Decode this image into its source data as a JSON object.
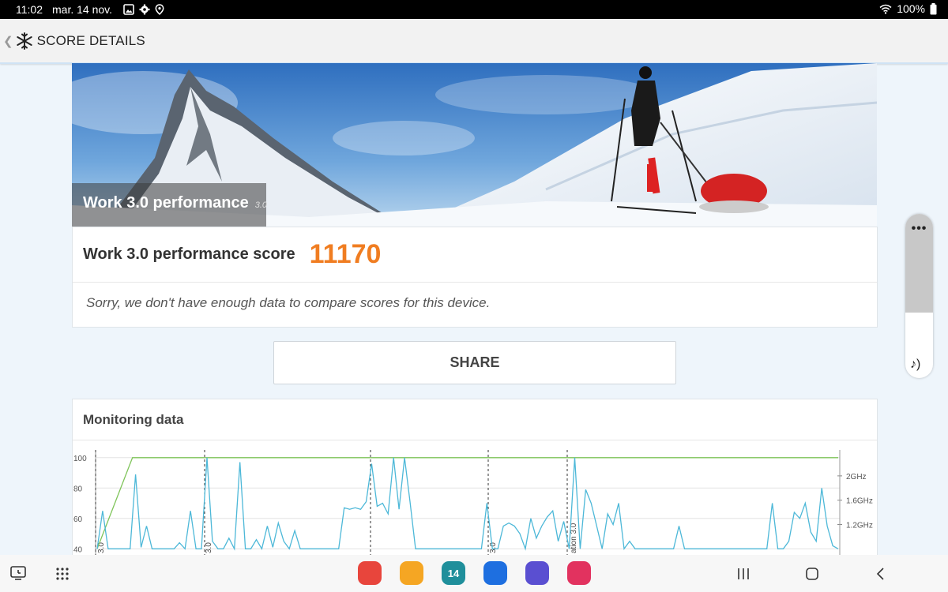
{
  "status_bar": {
    "time": "11:02",
    "date": "mar. 14 nov.",
    "battery": "100%",
    "icons": [
      "gallery-icon",
      "gear-icon",
      "location-icon",
      "wifi-icon",
      "battery-icon"
    ]
  },
  "app_bar": {
    "title": "SCORE DETAILS",
    "icons": [
      "back-icon",
      "snowflake-icon"
    ]
  },
  "hero": {
    "title": "Work 3.0 performance",
    "version": "3.0"
  },
  "score": {
    "label": "Work 3.0 performance score",
    "value": "11170",
    "compare_text": "Sorry, we don't have enough data to compare scores for this device."
  },
  "share_button": {
    "label": "SHARE"
  },
  "monitoring": {
    "title": "Monitoring data"
  },
  "chart_data": {
    "type": "line",
    "y_left_ticks": [
      "100",
      "80",
      "60",
      "40"
    ],
    "y_right_ticks": [
      "2GHz",
      "1.6GHz",
      "1.2GHz"
    ],
    "ylim": [
      36,
      103
    ],
    "marker_labels": [
      "3.0",
      "3.0",
      "3.0",
      "ation 3.0"
    ],
    "series": [
      {
        "color": "#7fc45a",
        "values": [
          40,
          100,
          100,
          100,
          100,
          100,
          100,
          100,
          100,
          100,
          100,
          100,
          100,
          100,
          100,
          100,
          100,
          100,
          100,
          100,
          100,
          100
        ]
      },
      {
        "color": "#4db8d8",
        "values": [
          40,
          65,
          40,
          40,
          40,
          40,
          40,
          89,
          41,
          55,
          40,
          40,
          40,
          40,
          40,
          44,
          40,
          65,
          40,
          40,
          100,
          45,
          40,
          40,
          47,
          40,
          97,
          40,
          40,
          46,
          40,
          55,
          41,
          57,
          45,
          40,
          52,
          40,
          40,
          40,
          40,
          40,
          40,
          40,
          40,
          67,
          66,
          67,
          66,
          71,
          96,
          68,
          70,
          63,
          100,
          66,
          100,
          71,
          40,
          40,
          40,
          40,
          40,
          40,
          40,
          40,
          40,
          40,
          40,
          40,
          40,
          70,
          40,
          40,
          55,
          57,
          55,
          50,
          40,
          60,
          47,
          55,
          61,
          65,
          45,
          58,
          40,
          100,
          40,
          79,
          70,
          55,
          40,
          63,
          56,
          70,
          40,
          45,
          40,
          40,
          40,
          40,
          40,
          40,
          40,
          40,
          55,
          40,
          40,
          40,
          40,
          40,
          40,
          40,
          40,
          40,
          40,
          40,
          40,
          40,
          40,
          40,
          40,
          70,
          40,
          40,
          45,
          64,
          60,
          70,
          51,
          45,
          80,
          55,
          42,
          40
        ]
      }
    ]
  },
  "side_panel": {
    "menu_icon": "more-dots-icon",
    "sound_icon": "sound-icon",
    "level": 0.6
  },
  "nav_bar": {
    "apps": [
      {
        "name": "notes-app-icon",
        "color": "#e8453c",
        "label": ""
      },
      {
        "name": "files-app-icon",
        "color": "#f5a623",
        "label": ""
      },
      {
        "name": "calendar-app-icon",
        "color": "#1f8f9b",
        "label": "14"
      },
      {
        "name": "messages-app-icon",
        "color": "#1e6fe0",
        "label": ""
      },
      {
        "name": "internet-app-icon",
        "color": "#5a4fd1",
        "label": ""
      },
      {
        "name": "camera-app-icon",
        "color": "#e2325f",
        "label": ""
      }
    ]
  }
}
